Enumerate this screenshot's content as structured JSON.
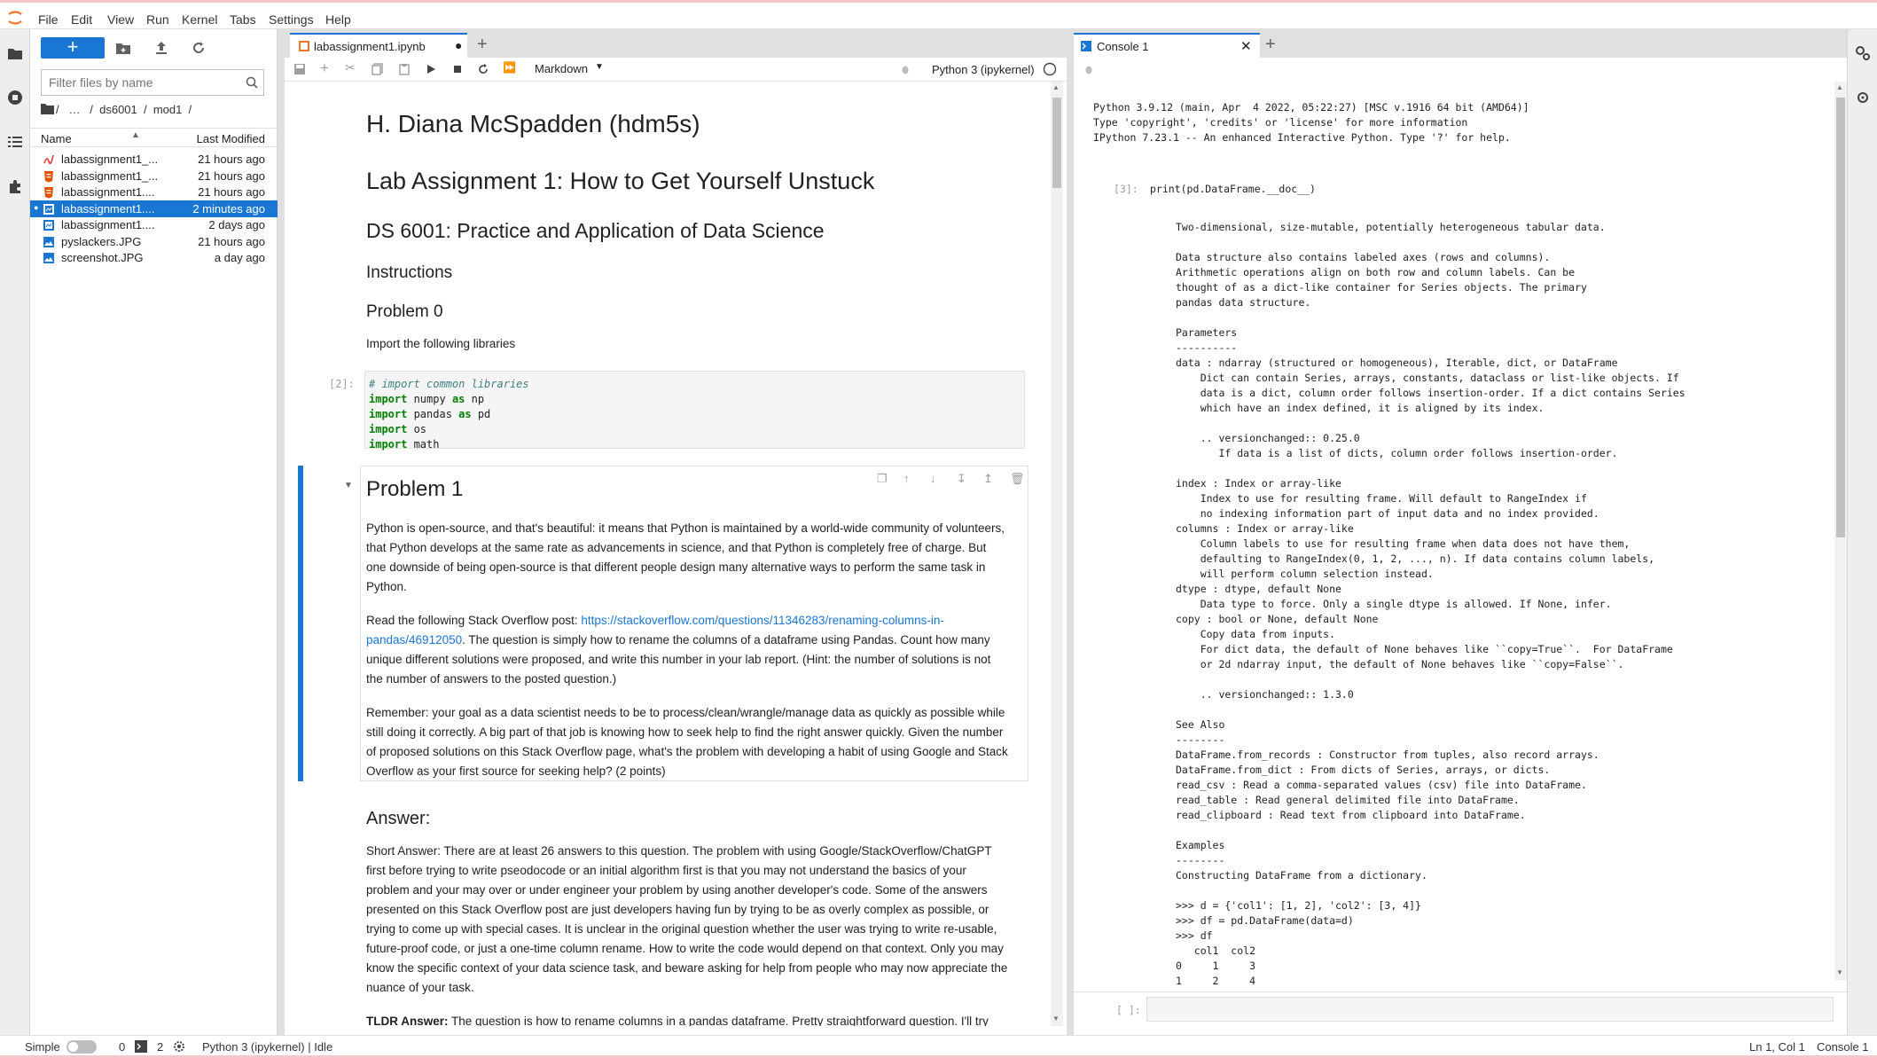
{
  "menu": [
    "File",
    "Edit",
    "View",
    "Run",
    "Kernel",
    "Tabs",
    "Settings",
    "Help"
  ],
  "file_browser": {
    "new_label": "+",
    "filter_placeholder": "Filter files by name",
    "breadcrumb": "/   …   /  ds6001  /  mod1  /",
    "col_name": "Name",
    "col_modified": "Last Modified",
    "files": [
      {
        "name": "labassignment1_...",
        "modified": "21 hours ago",
        "icon": "pdf-icon",
        "color": "#e53935"
      },
      {
        "name": "labassignment1_...",
        "modified": "21 hours ago",
        "icon": "html-icon",
        "color": "#e65100"
      },
      {
        "name": "labassignment1....",
        "modified": "21 hours ago",
        "icon": "html-icon",
        "color": "#e65100"
      },
      {
        "name": "labassignment1....",
        "modified": "2 minutes ago",
        "icon": "notebook-icon",
        "color": "#ffffff",
        "selected": true
      },
      {
        "name": "labassignment1....",
        "modified": "2 days ago",
        "icon": "notebook-icon",
        "color": "#1976d2"
      },
      {
        "name": "pyslackers.JPG",
        "modified": "21 hours ago",
        "icon": "image-icon",
        "color": "#1976d2"
      },
      {
        "name": "screenshot.JPG",
        "modified": "a day ago",
        "icon": "image-icon",
        "color": "#1976d2"
      }
    ]
  },
  "notebook": {
    "tab_title": "labassignment1.ipynb",
    "cell_type": "Markdown",
    "kernel": "Python 3 (ipykernel)",
    "h_name": "H. Diana McSpadden (hdm5s)",
    "h_lab": "Lab Assignment 1: How to Get Yourself Unstuck",
    "h_course": "DS 6001: Practice and Application of Data Science",
    "h_instructions": "Instructions",
    "h_problem0": "Problem 0",
    "p_import": "Import the following libraries",
    "code_prompt": "[2]:",
    "code_comment": "# import common libraries",
    "h_problem1": "Problem 1",
    "p1": "Python is open-source, and that's beautiful: it means that Python is maintained by a world-wide community of volunteers, that Python develops at the same rate as advancements in science, and that Python is completely free of charge. But one downside of being open-source is that different people design many alternative ways to perform the same task in Python.",
    "p2_pre": "Read the following Stack Overflow post: ",
    "p2_link": "https://stackoverflow.com/questions/11346283/renaming-columns-in-pandas/46912050",
    "p2_post": ". The question is simply how to rename the columns of a dataframe using Pandas. Count how many unique different solutions were proposed, and write this number in your lab report. (Hint: the number of solutions is not the number of answers to the posted question.)",
    "p3": "Remember: your goal as a data scientist needs to be to process/clean/wrangle/manage data as quickly as possible while still doing it correctly. A big part of that job is knowing how to seek help to find the right answer quickly. Given the number of proposed solutions on this Stack Overflow page, what's the problem with developing a habit of using Google and Stack Overflow as your first source for seeking help? (2 points)",
    "h_answer": "Answer:",
    "p4": "Short Answer: There are at least 26 answers to this question. The problem with using Google/StackOverflow/ChatGPT first before trying to write pseodocode or an initial algorithm first is that you may not understand the basics of your problem and your may over or under engineer your problem by using another developer's code. Some of the answers presented on this Stack Overflow post are just developers having fun by trying to be as overly complex as possible, or trying to come up with special cases. It is unclear in the original question whether the user was trying to write re-usable, future-proof code, or just a one-time column rename. How to write the code would depend on that context. Only you may know the specific context of your data science task, and beware asking for help from people who may now appreciate the nuance of your task.",
    "p5_bold": "TLDR Answer:",
    "p5": " The question is how to rename columns in a pandas dataframe. Pretty straightforward question. I'll try"
  },
  "console": {
    "tab_title": "Console 1",
    "banner": "Python 3.9.12 (main, Apr  4 2022, 05:22:27) [MSC v.1916 64 bit (AMD64)]\nType 'copyright', 'credits' or 'license' for more information\nIPython 7.23.1 -- An enhanced Interactive Python. Type '?' for help.",
    "in_prompt": "[3]:",
    "in_code": "print(pd.DataFrame.__doc__)",
    "output": "Two-dimensional, size-mutable, potentially heterogeneous tabular data.\n\nData structure also contains labeled axes (rows and columns).\nArithmetic operations align on both row and column labels. Can be\nthought of as a dict-like container for Series objects. The primary\npandas data structure.\n\nParameters\n----------\ndata : ndarray (structured or homogeneous), Iterable, dict, or DataFrame\n    Dict can contain Series, arrays, constants, dataclass or list-like objects. If\n    data is a dict, column order follows insertion-order. If a dict contains Series\n    which have an index defined, it is aligned by its index.\n\n    .. versionchanged:: 0.25.0\n       If data is a list of dicts, column order follows insertion-order.\n\nindex : Index or array-like\n    Index to use for resulting frame. Will default to RangeIndex if\n    no indexing information part of input data and no index provided.\ncolumns : Index or array-like\n    Column labels to use for resulting frame when data does not have them,\n    defaulting to RangeIndex(0, 1, 2, ..., n). If data contains column labels,\n    will perform column selection instead.\ndtype : dtype, default None\n    Data type to force. Only a single dtype is allowed. If None, infer.\ncopy : bool or None, default None\n    Copy data from inputs.\n    For dict data, the default of None behaves like ``copy=True``.  For DataFrame\n    or 2d ndarray input, the default of None behaves like ``copy=False``.\n\n    .. versionchanged:: 1.3.0\n\nSee Also\n--------\nDataFrame.from_records : Constructor from tuples, also record arrays.\nDataFrame.from_dict : From dicts of Series, arrays, or dicts.\nread_csv : Read a comma-separated values (csv) file into DataFrame.\nread_table : Read general delimited file into DataFrame.\nread_clipboard : Read text from clipboard into DataFrame.\n\nExamples\n--------\nConstructing DataFrame from a dictionary.\n\n>>> d = {'col1': [1, 2], 'col2': [3, 4]}\n>>> df = pd.DataFrame(data=d)\n>>> df\n   col1  col2\n0     1     3\n1     2     4",
    "input_prompt": "[ ]:"
  },
  "status": {
    "mode": "Simple",
    "count_a": "0",
    "count_b": "2",
    "kernel_status": "Python 3 (ipykernel) | Idle",
    "cursor": "Ln 1, Col 1",
    "active": "Console 1"
  }
}
